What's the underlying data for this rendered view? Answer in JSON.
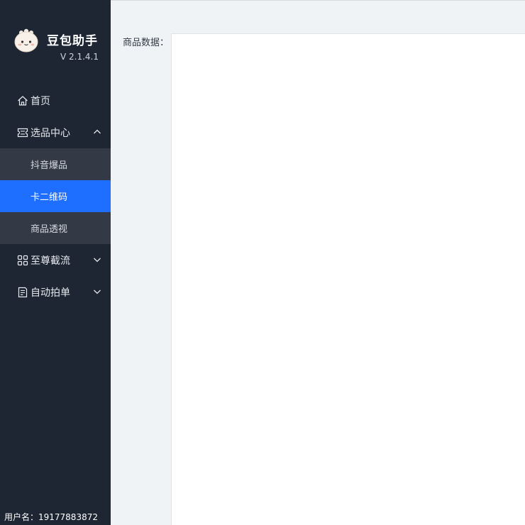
{
  "brand": {
    "name": "豆包助手",
    "version": "V 2.1.4.1",
    "logo_icon": "bun-mascot-icon"
  },
  "menu": {
    "home": {
      "label": "首页",
      "icon": "home-icon"
    },
    "product_center": {
      "label": "选品中心",
      "icon": "ticket-icon",
      "expanded": true,
      "children": [
        {
          "label": "抖音爆品",
          "active": false
        },
        {
          "label": "卡二维码",
          "active": true
        },
        {
          "label": "商品透视",
          "active": false
        }
      ]
    },
    "supreme_intercept": {
      "label": "至尊截流",
      "icon": "grid-icon",
      "expanded": false
    },
    "auto_order": {
      "label": "自动拍单",
      "icon": "document-icon",
      "expanded": false
    }
  },
  "user": {
    "text": "用户名：19177883872"
  },
  "main": {
    "product_data_label": "商品数据："
  },
  "colors": {
    "sidebar_bg": "#1e2633",
    "submenu_bg": "#333a45",
    "active_bg": "#1e6fff",
    "main_bg": "#f0f3f6"
  }
}
